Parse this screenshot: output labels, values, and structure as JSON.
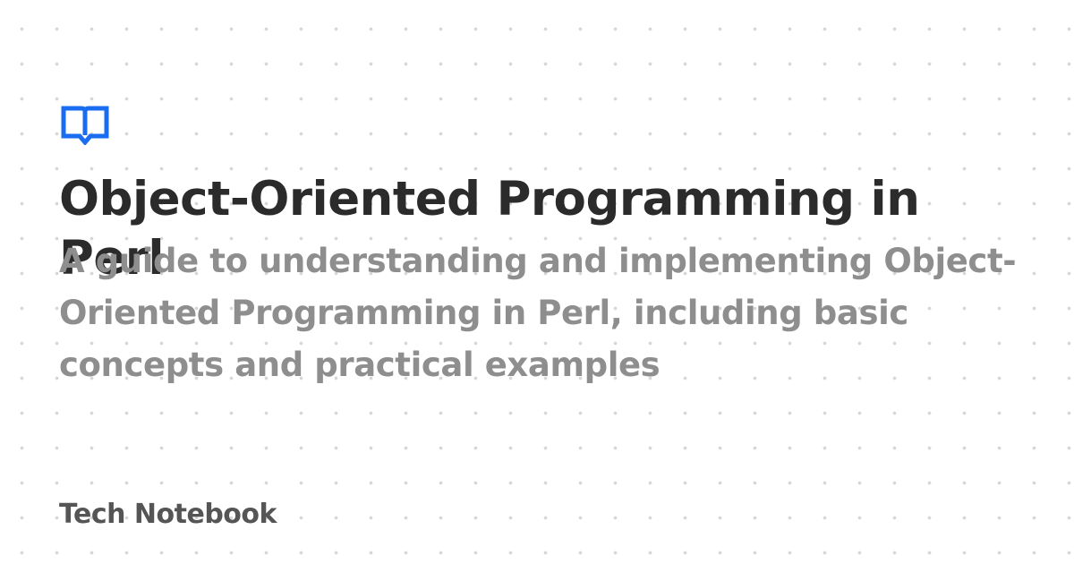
{
  "logo": {
    "icon": "open-book-icon",
    "color": "#1a6cf0"
  },
  "title": "Object-Oriented Programming in Perl",
  "subtitle": "A guide to understanding and implementing Object-Oriented Programming in Perl, including basic concepts and practical examples",
  "site_name": "Tech Notebook",
  "colors": {
    "background": "#ffffff",
    "dots": "#d6d6d6",
    "title": "#2b2b2b",
    "subtitle": "#8e8e8e",
    "site_name": "#555555",
    "accent": "#1a6cf0"
  }
}
